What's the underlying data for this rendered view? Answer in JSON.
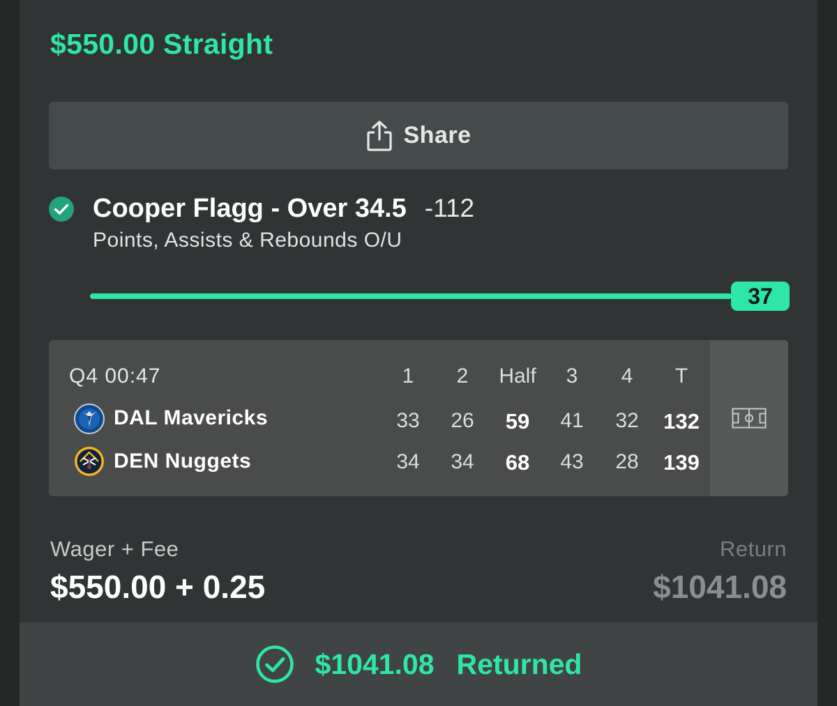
{
  "bet": {
    "title": "$550.00 Straight"
  },
  "share": {
    "label": "Share",
    "icon": "share-icon"
  },
  "selection": {
    "status_icon": "check-circle-icon",
    "name": "Cooper Flagg - Over 34.5",
    "odds": "-112",
    "market": "Points, Assists & Rebounds O/U",
    "progress_value": "37",
    "progress_fraction": 1.0
  },
  "scoreboard": {
    "clock": "Q4 00:47",
    "columns": [
      "1",
      "2",
      "Half",
      "3",
      "4",
      "T"
    ],
    "teams": [
      {
        "name": "DAL Mavericks",
        "logo_icon": "mavericks-logo-icon",
        "scores": [
          "33",
          "26",
          "59",
          "41",
          "32",
          "132"
        ]
      },
      {
        "name": "DEN Nuggets",
        "logo_icon": "nuggets-logo-icon",
        "scores": [
          "34",
          "34",
          "68",
          "43",
          "28",
          "139"
        ]
      }
    ],
    "court_icon": "basketball-court-icon"
  },
  "wager": {
    "label": "Wager + Fee",
    "value": "$550.00 + 0.25"
  },
  "return": {
    "label": "Return",
    "value": "$1041.08"
  },
  "footer": {
    "icon": "check-circle-outline-icon",
    "amount": "$1041.08",
    "status": "Returned"
  },
  "colors": {
    "accent": "#2ee6a8",
    "card_bg": "#303434",
    "scoreboard_bg": "#4a4b4b"
  }
}
